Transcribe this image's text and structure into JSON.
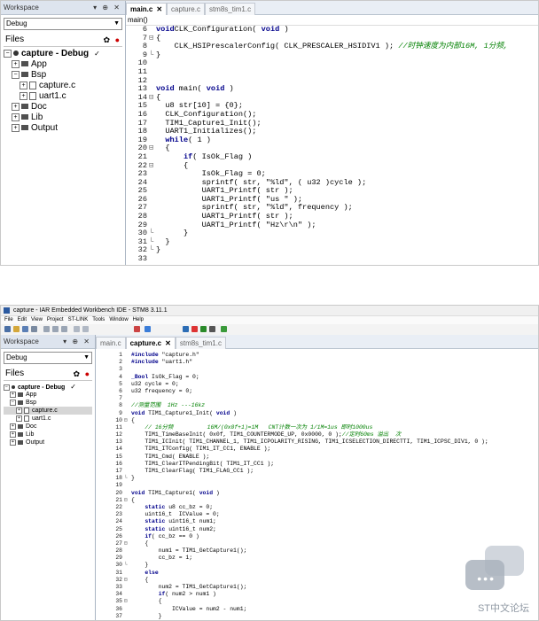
{
  "shot1": {
    "workspace": {
      "title": "Workspace",
      "controls": "▾ ⊕ ✕",
      "config": "Debug",
      "files_header": "Files",
      "tree": [
        {
          "label": "capture - Debug",
          "kind": "root",
          "depth": 0,
          "check": "✓",
          "expander": "⊟"
        },
        {
          "label": "App",
          "kind": "folder",
          "depth": 1,
          "expander": "⊞"
        },
        {
          "label": "Bsp",
          "kind": "folder",
          "depth": 1,
          "expander": "⊟"
        },
        {
          "label": "capture.c",
          "kind": "file",
          "depth": 2,
          "expander": "⊞"
        },
        {
          "label": "uart1.c",
          "kind": "file",
          "depth": 2,
          "expander": "⊞"
        },
        {
          "label": "Doc",
          "kind": "folder",
          "depth": 1,
          "expander": "⊞"
        },
        {
          "label": "Lib",
          "kind": "folder",
          "depth": 1,
          "expander": "⊞"
        },
        {
          "label": "Output",
          "kind": "folder",
          "depth": 1,
          "expander": "⊞"
        }
      ]
    },
    "tabs": [
      {
        "label": "main.c",
        "active": true
      },
      {
        "label": "capture.c",
        "active": false
      },
      {
        "label": "stm8s_tim1.c",
        "active": false
      }
    ],
    "tab_close": "✕",
    "function": "main()",
    "lines": [
      {
        "n": "6",
        "f": "",
        "segs": [
          [
            "kw",
            "void"
          ],
          [
            "",
            "CLK_Configuration( "
          ],
          [
            "kw",
            "void"
          ],
          [
            "",
            " )"
          ]
        ]
      },
      {
        "n": "7",
        "f": "⊟",
        "segs": [
          [
            "",
            "{"
          ]
        ]
      },
      {
        "n": "8",
        "f": "",
        "segs": [
          [
            "",
            "    CLK_HSIPrescalerConfig( CLK_PRESCALER_HSIDIV1 ); "
          ],
          [
            "cm",
            "//时钟速度为内部16M, 1分频,"
          ]
        ]
      },
      {
        "n": "9",
        "f": "└",
        "segs": [
          [
            "",
            "}"
          ]
        ]
      },
      {
        "n": "10",
        "f": "",
        "segs": []
      },
      {
        "n": "11",
        "f": "",
        "segs": []
      },
      {
        "n": "12",
        "f": "",
        "segs": []
      },
      {
        "n": "13",
        "f": "",
        "segs": [
          [
            "kw",
            "void"
          ],
          [
            "",
            " main( "
          ],
          [
            "kw",
            "void"
          ],
          [
            "",
            " )"
          ]
        ]
      },
      {
        "n": "14",
        "f": "⊟",
        "segs": [
          [
            "",
            "{"
          ]
        ]
      },
      {
        "n": "15",
        "f": "",
        "segs": [
          [
            "",
            "  u8 str[10] = {0};"
          ]
        ]
      },
      {
        "n": "16",
        "f": "",
        "segs": [
          [
            "",
            "  CLK_Configuration();"
          ]
        ]
      },
      {
        "n": "17",
        "f": "",
        "segs": [
          [
            "",
            "  TIM1_Capture1_Init();"
          ]
        ]
      },
      {
        "n": "18",
        "f": "",
        "segs": [
          [
            "",
            "  UART1_Initializes();"
          ]
        ]
      },
      {
        "n": "19",
        "f": "",
        "segs": [
          [
            "",
            "  "
          ],
          [
            "kw",
            "while"
          ],
          [
            "",
            "( 1 )"
          ]
        ]
      },
      {
        "n": "20",
        "f": "⊟",
        "segs": [
          [
            "",
            "  {"
          ]
        ]
      },
      {
        "n": "21",
        "f": "",
        "segs": [
          [
            "",
            "      "
          ],
          [
            "kw",
            "if"
          ],
          [
            "",
            "( IsOk_Flag )"
          ]
        ]
      },
      {
        "n": "22",
        "f": "⊟",
        "segs": [
          [
            "",
            "      {"
          ]
        ]
      },
      {
        "n": "23",
        "f": "",
        "segs": [
          [
            "",
            "          IsOk_Flag = 0;"
          ]
        ]
      },
      {
        "n": "24",
        "f": "",
        "segs": [
          [
            "",
            "          sprintf( str, "
          ],
          [
            "st",
            "\"%ld\""
          ],
          [
            "",
            ", ( u32 )cycle );"
          ]
        ]
      },
      {
        "n": "25",
        "f": "",
        "segs": [
          [
            "",
            "          UART1_Printf( str );"
          ]
        ]
      },
      {
        "n": "26",
        "f": "",
        "segs": [
          [
            "",
            "          UART1_Printf( "
          ],
          [
            "st",
            "\"us \""
          ],
          [
            "",
            " );"
          ]
        ]
      },
      {
        "n": "27",
        "f": "",
        "segs": [
          [
            "",
            "          sprintf( str, "
          ],
          [
            "st",
            "\"%ld\""
          ],
          [
            "",
            ", frequency );"
          ]
        ]
      },
      {
        "n": "28",
        "f": "",
        "segs": [
          [
            "",
            "          UART1_Printf( str );"
          ]
        ]
      },
      {
        "n": "29",
        "f": "",
        "segs": [
          [
            "",
            "          UART1_Printf( "
          ],
          [
            "st",
            "\"Hz\\r\\n\""
          ],
          [
            "",
            " );"
          ]
        ]
      },
      {
        "n": "30",
        "f": "└",
        "segs": [
          [
            "",
            "      }"
          ]
        ]
      },
      {
        "n": "31",
        "f": "└",
        "segs": [
          [
            "",
            "  }"
          ]
        ]
      },
      {
        "n": "32",
        "f": "└",
        "segs": [
          [
            "",
            "}"
          ]
        ]
      },
      {
        "n": "33",
        "f": "",
        "segs": []
      }
    ]
  },
  "shot2": {
    "window_title": "capture - IAR Embedded Workbench IDE - STM8 3.11.1",
    "menu": [
      "File",
      "Edit",
      "View",
      "Project",
      "ST-LINK",
      "Tools",
      "Window",
      "Help"
    ],
    "workspace": {
      "title": "Workspace",
      "controls": "▾ ⊕ ✕",
      "config": "Debug",
      "files_header": "Files",
      "tree": [
        {
          "label": "capture - Debug",
          "kind": "root",
          "depth": 0,
          "check": "✓",
          "expander": "⊟"
        },
        {
          "label": "App",
          "kind": "folder",
          "depth": 1,
          "expander": "⊞"
        },
        {
          "label": "Bsp",
          "kind": "folder",
          "depth": 1,
          "expander": "⊟"
        },
        {
          "label": "capture.c",
          "kind": "file",
          "depth": 2,
          "expander": "⊞",
          "selected": true
        },
        {
          "label": "uart1.c",
          "kind": "file",
          "depth": 2,
          "expander": "⊞"
        },
        {
          "label": "Doc",
          "kind": "folder",
          "depth": 1,
          "expander": "⊞"
        },
        {
          "label": "Lib",
          "kind": "folder",
          "depth": 1,
          "expander": "⊞"
        },
        {
          "label": "Output",
          "kind": "folder",
          "depth": 1,
          "expander": "⊞"
        }
      ]
    },
    "tabs": [
      {
        "label": "main.c",
        "active": false
      },
      {
        "label": "capture.c",
        "active": true
      },
      {
        "label": "stm8s_tim1.c",
        "active": false
      }
    ],
    "tab_close": "✕",
    "lines": [
      {
        "n": "1",
        "f": "",
        "segs": [
          [
            "kw",
            "#include"
          ],
          [
            "",
            " "
          ],
          [
            "st",
            "\"capture.h\""
          ]
        ]
      },
      {
        "n": "2",
        "f": "",
        "segs": [
          [
            "kw",
            "#include"
          ],
          [
            "",
            " "
          ],
          [
            "st",
            "\"uart1.h\""
          ]
        ]
      },
      {
        "n": "3",
        "f": "",
        "segs": []
      },
      {
        "n": "4",
        "f": "",
        "segs": [
          [
            "kw",
            "_Bool"
          ],
          [
            "",
            " IsOk_Flag = 0;"
          ]
        ]
      },
      {
        "n": "5",
        "f": "",
        "segs": [
          [
            "",
            "u32 cycle = 0;"
          ]
        ]
      },
      {
        "n": "6",
        "f": "",
        "segs": [
          [
            "",
            "u32 frequency = 0;"
          ]
        ]
      },
      {
        "n": "7",
        "f": "",
        "segs": []
      },
      {
        "n": "8",
        "f": "",
        "segs": [
          [
            "cm",
            "//测量范围  1Hz ---16kz"
          ]
        ]
      },
      {
        "n": "9",
        "f": "",
        "segs": [
          [
            "kw",
            "void"
          ],
          [
            "",
            " TIM1_Capture1_Init( "
          ],
          [
            "kw",
            "void"
          ],
          [
            "",
            " )"
          ]
        ]
      },
      {
        "n": "10",
        "f": "⊟",
        "segs": [
          [
            "",
            "{"
          ]
        ]
      },
      {
        "n": "11",
        "f": "",
        "segs": [
          [
            "",
            "    "
          ],
          [
            "cm",
            "// 16分频          16M/(0x0f+1)=1M   CNT计数一次为 1/1M=1us 即时1000us"
          ]
        ]
      },
      {
        "n": "12",
        "f": "",
        "segs": [
          [
            "",
            "    TIM1_TimeBaseInit( 0x0f, TIM1_COUNTERMODE_UP, 0x0000, 0 );"
          ],
          [
            "cm",
            "//定时60ms 溢出  次"
          ]
        ]
      },
      {
        "n": "13",
        "f": "",
        "segs": [
          [
            "",
            "    TIM1_ICInit( TIM1_CHANNEL_1, TIM1_ICPOLARITY_RISING, TIM1_ICSELECTION_DIRECTTI, TIM1_ICPSC_DIV1, 0 );"
          ]
        ]
      },
      {
        "n": "14",
        "f": "",
        "segs": [
          [
            "",
            "    TIM1_ITConfig( TIM1_IT_CC1, ENABLE );"
          ]
        ]
      },
      {
        "n": "15",
        "f": "",
        "segs": [
          [
            "",
            "    TIM1_Cmd( ENABLE );"
          ]
        ]
      },
      {
        "n": "16",
        "f": "",
        "segs": [
          [
            "",
            "    TIM1_ClearITPendingBit( TIM1_IT_CC1 );"
          ]
        ]
      },
      {
        "n": "17",
        "f": "",
        "segs": [
          [
            "",
            "    TIM1_ClearFlag( TIM1_FLAG_CC1 );"
          ]
        ]
      },
      {
        "n": "18",
        "f": "└",
        "segs": [
          [
            "",
            "}"
          ]
        ]
      },
      {
        "n": "19",
        "f": "",
        "segs": []
      },
      {
        "n": "20",
        "f": "",
        "segs": [
          [
            "kw",
            "void"
          ],
          [
            "",
            " TIM1_Capture1( "
          ],
          [
            "kw",
            "void"
          ],
          [
            "",
            " )"
          ]
        ]
      },
      {
        "n": "21",
        "f": "⊟",
        "segs": [
          [
            "",
            "{"
          ]
        ]
      },
      {
        "n": "22",
        "f": "",
        "segs": [
          [
            "",
            "    "
          ],
          [
            "kw",
            "static"
          ],
          [
            "",
            " u8 cc_bz = 0;"
          ]
        ]
      },
      {
        "n": "23",
        "f": "",
        "segs": [
          [
            "",
            "    uint16_t  ICValue = 0;"
          ]
        ]
      },
      {
        "n": "24",
        "f": "",
        "segs": [
          [
            "",
            "    "
          ],
          [
            "kw",
            "static"
          ],
          [
            "",
            " uint16_t num1;"
          ]
        ]
      },
      {
        "n": "25",
        "f": "",
        "segs": [
          [
            "",
            "    "
          ],
          [
            "kw",
            "static"
          ],
          [
            "",
            " uint16_t num2;"
          ]
        ]
      },
      {
        "n": "26",
        "f": "",
        "segs": [
          [
            "",
            "    "
          ],
          [
            "kw",
            "if"
          ],
          [
            "",
            "( cc_bz == 0 )"
          ]
        ]
      },
      {
        "n": "27",
        "f": "⊟",
        "segs": [
          [
            "",
            "    {"
          ]
        ]
      },
      {
        "n": "28",
        "f": "",
        "segs": [
          [
            "",
            "        num1 = TIM1_GetCapture1();"
          ]
        ]
      },
      {
        "n": "29",
        "f": "",
        "segs": [
          [
            "",
            "        cc_bz = 1;"
          ]
        ]
      },
      {
        "n": "30",
        "f": "└",
        "segs": [
          [
            "",
            "    }"
          ]
        ]
      },
      {
        "n": "31",
        "f": "",
        "segs": [
          [
            "",
            "    "
          ],
          [
            "kw",
            "else"
          ]
        ]
      },
      {
        "n": "32",
        "f": "⊟",
        "segs": [
          [
            "",
            "    {"
          ]
        ]
      },
      {
        "n": "33",
        "f": "",
        "segs": [
          [
            "",
            "        num2 = TIM1_GetCapture1();"
          ]
        ]
      },
      {
        "n": "34",
        "f": "",
        "segs": [
          [
            "",
            "        "
          ],
          [
            "kw",
            "if"
          ],
          [
            "",
            "( num2 > num1 )"
          ]
        ]
      },
      {
        "n": "35",
        "f": "⊟",
        "segs": [
          [
            "",
            "        {"
          ]
        ]
      },
      {
        "n": "36",
        "f": "",
        "segs": [
          [
            "",
            "            ICValue = num2 - num1;"
          ]
        ]
      },
      {
        "n": "37",
        "f": "",
        "segs": [
          [
            "",
            "        }"
          ]
        ]
      }
    ]
  },
  "watermark": {
    "text": "ST中文论坛"
  }
}
